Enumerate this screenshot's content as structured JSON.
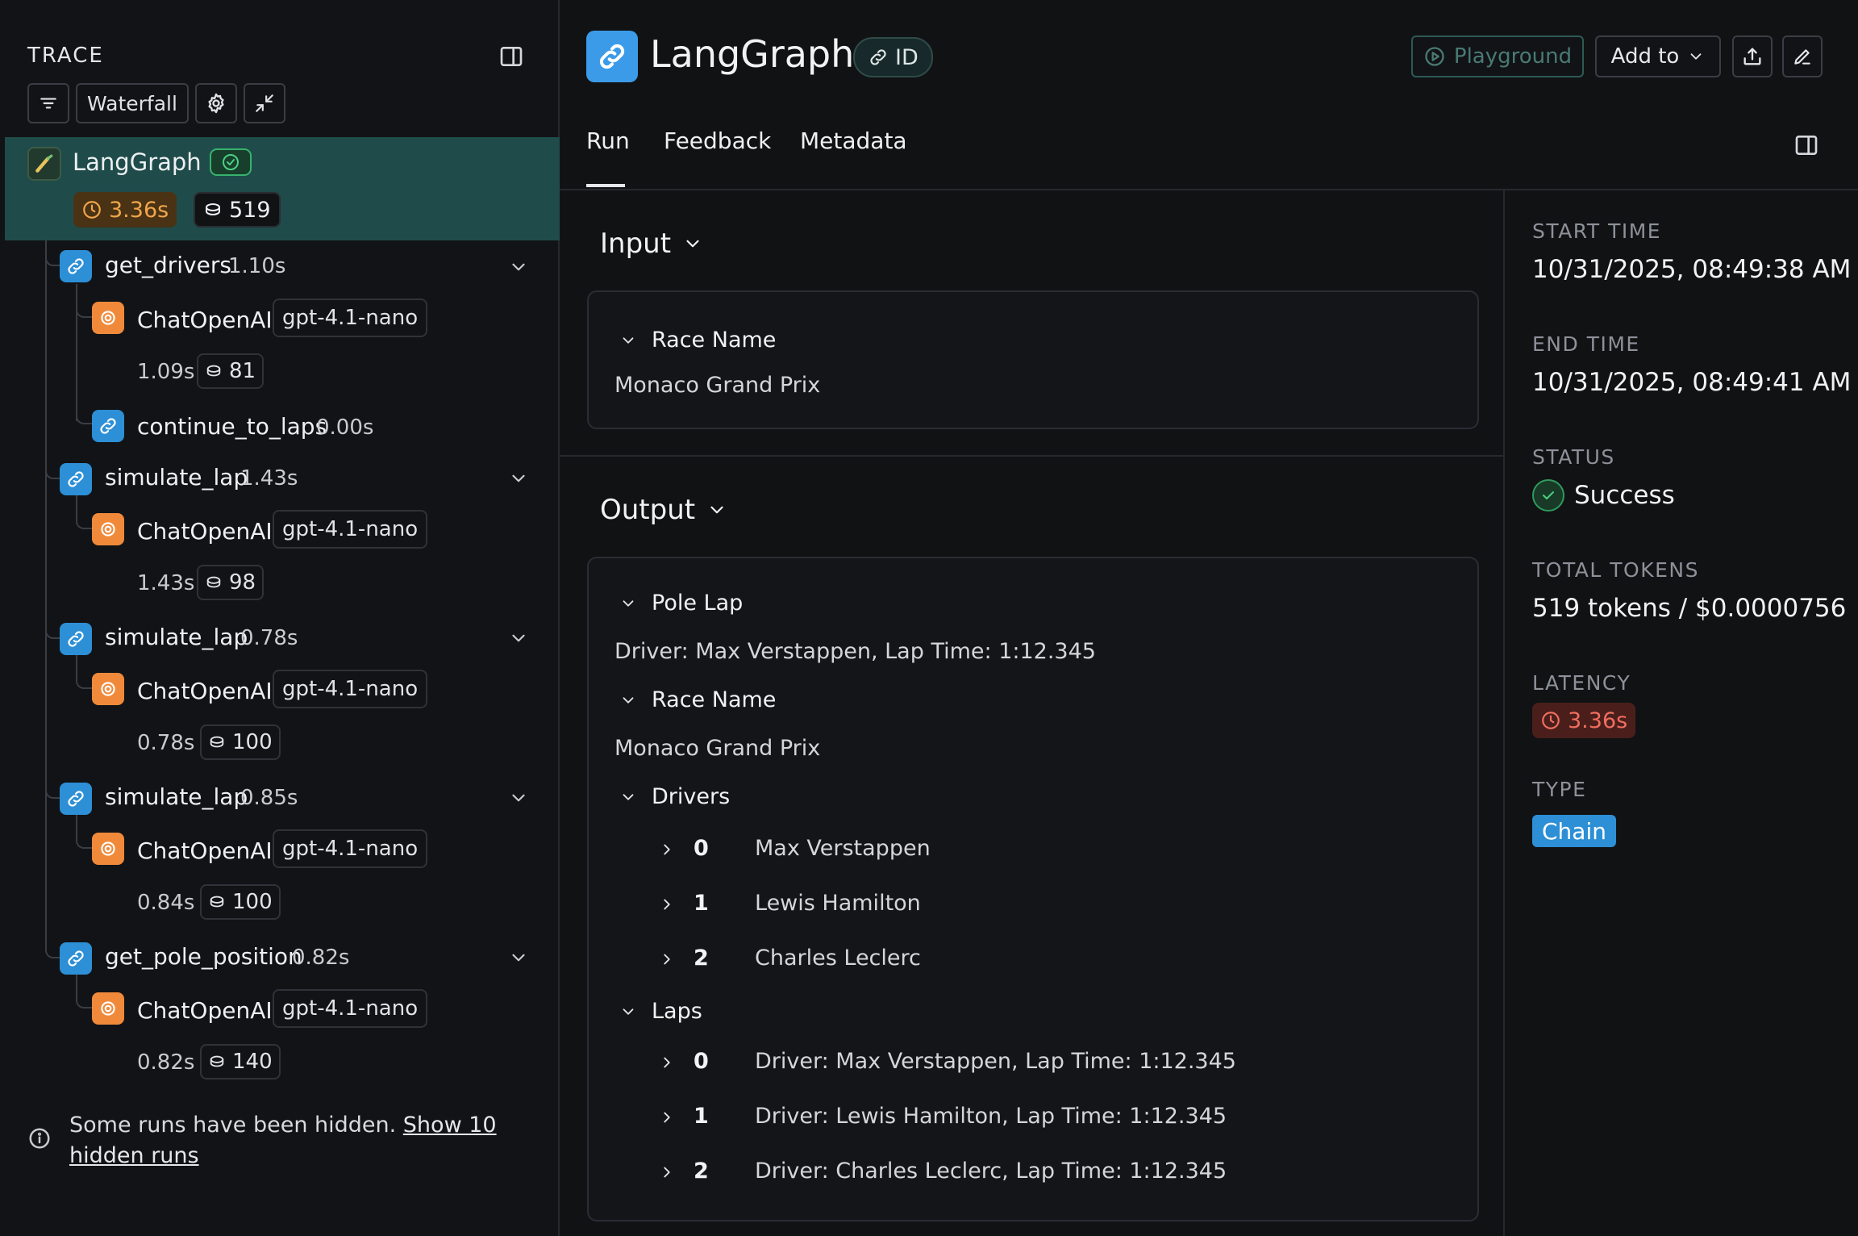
{
  "trace_panel": {
    "title": "TRACE",
    "toolbar": {
      "view_label": "Waterfall"
    },
    "root": {
      "name": "LangGraph",
      "latency": "3.36s",
      "tokens": "519"
    },
    "nodes": [
      {
        "name": "get_drivers",
        "time": "1.10s"
      },
      {
        "name": "ChatOpenAI",
        "model": "gpt-4.1-nano",
        "time": "1.09s",
        "tokens": "81"
      },
      {
        "name": "continue_to_laps",
        "time": "0.00s"
      },
      {
        "name": "simulate_lap",
        "time": "1.43s"
      },
      {
        "name": "ChatOpenAI",
        "model": "gpt-4.1-nano",
        "time": "1.43s",
        "tokens": "98"
      },
      {
        "name": "simulate_lap",
        "time": "0.78s"
      },
      {
        "name": "ChatOpenAI",
        "model": "gpt-4.1-nano",
        "time": "0.78s",
        "tokens": "100"
      },
      {
        "name": "simulate_lap",
        "time": "0.85s"
      },
      {
        "name": "ChatOpenAI",
        "model": "gpt-4.1-nano",
        "time": "0.84s",
        "tokens": "100"
      },
      {
        "name": "get_pole_position",
        "time": "0.82s"
      },
      {
        "name": "ChatOpenAI",
        "model": "gpt-4.1-nano",
        "time": "0.82s",
        "tokens": "140"
      }
    ],
    "hidden_note": {
      "text": "Some runs have been hidden. ",
      "link": "Show 10 hidden runs"
    }
  },
  "header": {
    "title": "LangGraph",
    "id_label": "ID",
    "playground_label": "Playground",
    "add_to_label": "Add to"
  },
  "tabs": [
    "Run",
    "Feedback",
    "Metadata"
  ],
  "input": {
    "title": "Input",
    "fields": [
      {
        "key": "Race Name",
        "value": "Monaco Grand Prix"
      }
    ]
  },
  "output": {
    "title": "Output",
    "pole_lap": {
      "key": "Pole Lap",
      "value": "Driver: Max Verstappen, Lap Time: 1:12.345"
    },
    "race_name": {
      "key": "Race Name",
      "value": "Monaco Grand Prix"
    },
    "drivers": {
      "key": "Drivers",
      "items": [
        {
          "index": "0",
          "value": "Max Verstappen"
        },
        {
          "index": "1",
          "value": "Lewis Hamilton"
        },
        {
          "index": "2",
          "value": "Charles Leclerc"
        }
      ]
    },
    "laps": {
      "key": "Laps",
      "items": [
        {
          "index": "0",
          "value": "Driver: Max Verstappen, Lap Time: 1:12.345"
        },
        {
          "index": "1",
          "value": "Driver: Lewis Hamilton, Lap Time: 1:12.345"
        },
        {
          "index": "2",
          "value": "Driver: Charles Leclerc, Lap Time: 1:12.345"
        }
      ]
    }
  },
  "metadata": {
    "start_time": {
      "label": "START TIME",
      "value": "10/31/2025, 08:49:38 AM"
    },
    "end_time": {
      "label": "END TIME",
      "value": "10/31/2025, 08:49:41 AM"
    },
    "status": {
      "label": "STATUS",
      "value": "Success"
    },
    "total_tokens": {
      "label": "TOTAL TOKENS",
      "value": "519 tokens / $0.0000756"
    },
    "latency": {
      "label": "LATENCY",
      "value": "3.36s"
    },
    "type": {
      "label": "TYPE",
      "value": "Chain"
    }
  },
  "colors": {
    "accent_teal": "#1f4c4a",
    "chain_blue": "#2d8fd6",
    "llm_orange": "#f08a3a",
    "success_green": "#4ad082",
    "latency_red": "#f06e5f"
  }
}
